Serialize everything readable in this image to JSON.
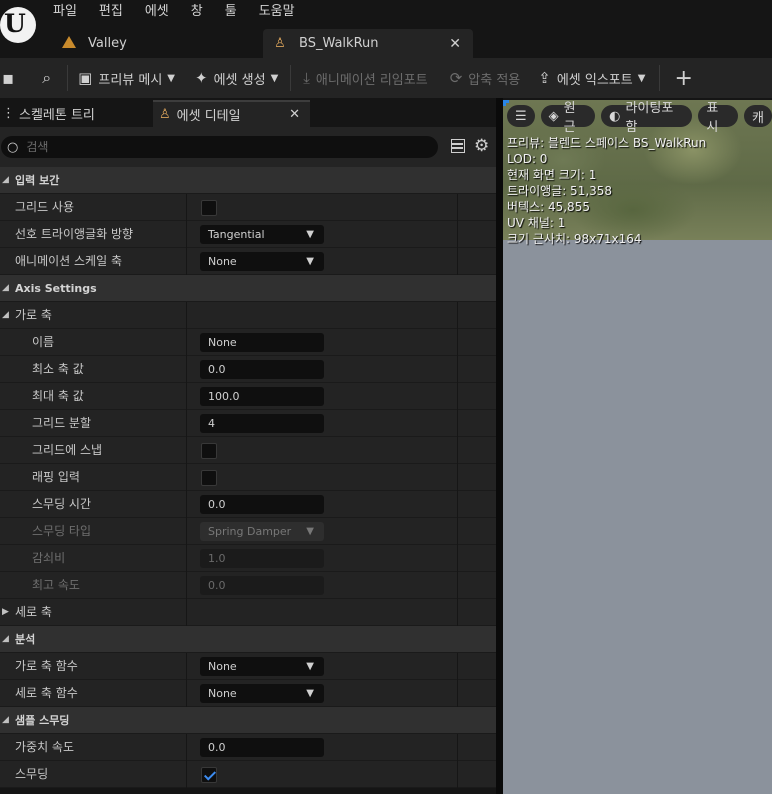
{
  "menu": [
    "파일",
    "편집",
    "에셋",
    "창",
    "툴",
    "도움말"
  ],
  "doc_tabs": {
    "valley": "Valley",
    "active": "BS_WalkRun"
  },
  "toolbar": {
    "preview_mesh": "프리뷰 메시",
    "create_asset": "에셋 생성",
    "reimport_animation": "애니메이션 리임포트",
    "apply_compression": "압축 적용",
    "export_asset": "에셋 익스포트"
  },
  "panel_tabs": {
    "skeleton_tree": "스켈레톤 트리",
    "asset_details": "에셋 디테일"
  },
  "search": {
    "placeholder": "검색"
  },
  "rows": {
    "cat_input_interp": "입력 보간",
    "use_grid": "그리드 사용",
    "pref_tri_dir": "선호 트라이앵글화 방향",
    "pref_tri_val": "Tangential",
    "anim_speed_axis": "애니메이션 스케일 축",
    "anim_speed_val": "None",
    "cat_axis_settings": "Axis Settings",
    "horizontal_axis": "가로 축",
    "name": "이름",
    "name_val": "None",
    "min_axis": "최소 축 값",
    "min_axis_val": "0.0",
    "max_axis": "최대 축 값",
    "max_axis_val": "100.0",
    "grid_divisions": "그리드 분할",
    "grid_divisions_val": "4",
    "snap_to_grid": "그리드에 스냅",
    "wrap_input": "래핑 입력",
    "smoothing_time": "스무딩 시간",
    "smoothing_time_val": "0.0",
    "smoothing_type": "스무딩 타입",
    "smoothing_type_val": "Spring Damper",
    "damping_ratio": "감쇠비",
    "damping_ratio_val": "1.0",
    "max_speed": "최고 속도",
    "max_speed_val": "0.0",
    "vertical_axis": "세로 축",
    "cat_analysis": "분석",
    "h_axis_func": "가로 축 함수",
    "h_axis_func_val": "None",
    "v_axis_func": "세로 축 함수",
    "v_axis_func_val": "None",
    "cat_sample_smoothing": "샘플 스무딩",
    "weight_speed": "가중치 속도",
    "weight_speed_val": "0.0",
    "smoothing": "스무딩"
  },
  "viewport": {
    "perspective": "원근",
    "lit": "라이팅포함",
    "show": "표시",
    "more": "캐",
    "info": [
      "프리뷰: 블렌드 스페이스 BS_WalkRun",
      "LOD: 0",
      "현재 화면 크기: 1",
      "트라이앵글: 51,358",
      "버텍스: 45,855",
      "UV 채널: 1",
      "크기 근사치: 98x71x164"
    ]
  }
}
